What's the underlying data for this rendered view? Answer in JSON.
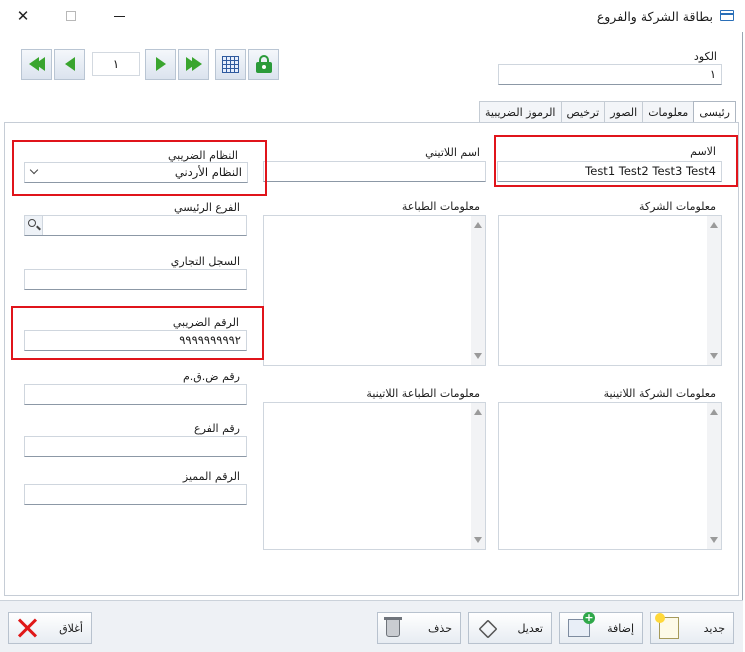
{
  "window": {
    "title": "بطاقة الشركة والفروع",
    "close_glyph": "✕"
  },
  "navigation": {
    "record_number": "١"
  },
  "code": {
    "label": "الكود",
    "value": "١"
  },
  "tabs": [
    {
      "label": "رئيسى",
      "active": true
    },
    {
      "label": "معلومات",
      "active": false
    },
    {
      "label": "الصور",
      "active": false
    },
    {
      "label": "ترخيص",
      "active": false
    },
    {
      "label": "الرموز الضريبية",
      "active": false
    }
  ],
  "main": {
    "name_label": "الاسم",
    "name_value": "Test1 Test2 Test3 Test4",
    "latin_name_label": "اسم اللاتيني",
    "latin_name_value": "",
    "tax_system_label": "النظام الضريبي",
    "tax_system_value": "النظام الأردني",
    "company_info_label": "معلومات الشركة",
    "print_info_label": "معلومات الطباعة",
    "main_branch_label": "الفرع الرئيسي",
    "commercial_register_label": "السجل التجاري",
    "tax_number_label": "الرقم الضريبي",
    "tax_number_value": "٩٩٩٩٩٩٩٩٩٢",
    "latin_company_info_label": "معلومات الشركة اللاتينية",
    "latin_print_info_label": "معلومات الطباعة اللاتينية",
    "sales_tax_number_label": "رقم ض.ق.م",
    "branch_number_label": "رقم الفرع",
    "distinguished_number_label": "الرقم المميز"
  },
  "actions": {
    "new_label": "جديد",
    "add_label": "إضافة",
    "edit_label": "تعديل",
    "delete_label": "حذف",
    "close_label": "أغلاق"
  },
  "colors": {
    "highlight_red": "#e0141b",
    "nav_green": "#3aa52e",
    "panel_border": "#c6cdd6"
  }
}
